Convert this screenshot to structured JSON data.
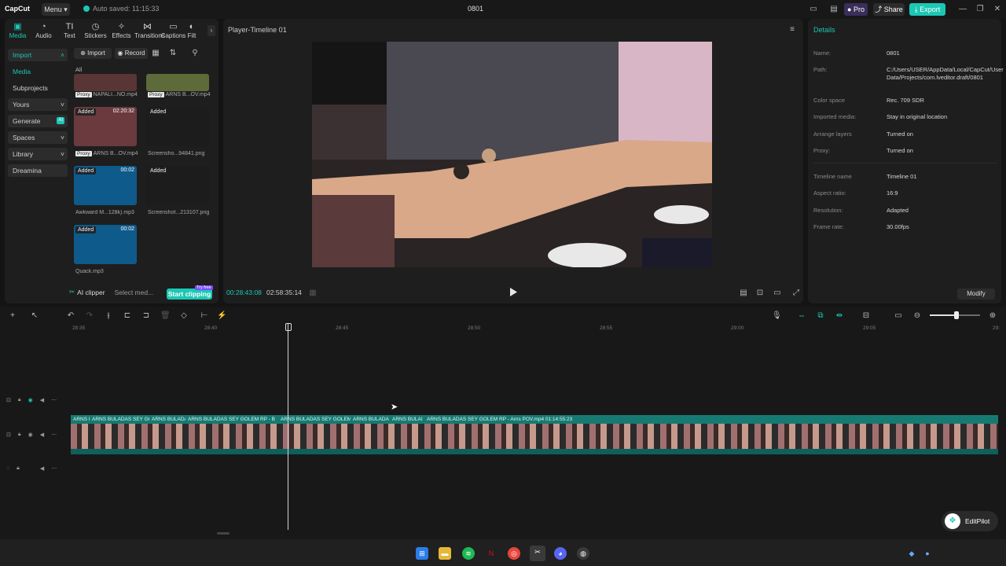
{
  "titlebar": {
    "app_name": "CapCut",
    "menu_label": "Menu",
    "autosave_text": "Auto saved: 11:15:33",
    "project_title": "0801",
    "pro_label": "Pro",
    "share_label": "Share",
    "export_label": "Export"
  },
  "tabs": [
    {
      "label": "Media",
      "icon": "media-icon"
    },
    {
      "label": "Audio",
      "icon": "audio-icon"
    },
    {
      "label": "Text",
      "icon": "text-icon"
    },
    {
      "label": "Stickers",
      "icon": "stickers-icon"
    },
    {
      "label": "Effects",
      "icon": "effects-icon"
    },
    {
      "label": "Transitions",
      "icon": "transitions-icon"
    },
    {
      "label": "Captions",
      "icon": "captions-icon"
    },
    {
      "label": "Filt",
      "icon": "filters-icon"
    }
  ],
  "sidenav": {
    "import": "Import",
    "media": "Media",
    "subprojects": "Subprojects",
    "yours": "Yours",
    "generate": "Generate",
    "generate_badge": "AI",
    "spaces": "Spaces",
    "library": "Library",
    "dreamina": "Dreamina"
  },
  "media": {
    "import_label": "Import",
    "record_label": "Record",
    "filter_all": "All",
    "proxy_label": "Proxy",
    "added_label": "Added",
    "items": [
      {
        "name": "NAPALI...NO.mp4",
        "duration": "",
        "added": false,
        "proxy": true
      },
      {
        "name": "ARNS B...OV.mp4",
        "duration": "",
        "added": false,
        "proxy": true
      },
      {
        "name": "ARNS B...OV.mp4",
        "duration": "02:20:32",
        "added": true,
        "proxy": true
      },
      {
        "name": "Screensho...94841.png",
        "duration": "",
        "added": true,
        "proxy": false
      },
      {
        "name": "Awkward M...128k).mp3",
        "duration": "00:02",
        "added": true,
        "proxy": false
      },
      {
        "name": "Screenshot...213107.png",
        "duration": "",
        "added": true,
        "proxy": false
      },
      {
        "name": "Quack.mp3",
        "duration": "00:02",
        "added": true,
        "proxy": false
      }
    ],
    "ai_clipper": "AI clipper",
    "select_media": "Select med...",
    "start_clipping": "Start clipping",
    "try_free": "Try free"
  },
  "player": {
    "title": "Player-Timeline 01",
    "current_time": "00:28:43:08",
    "total_time": "02:58:35:14"
  },
  "details": {
    "title": "Details",
    "rows": [
      {
        "key": "Name:",
        "value": "0801"
      },
      {
        "key": "Path:",
        "value": "C:/Users/USER/AppData/Local/CapCut/User Data/Projects/com.lveditor.draft/0801"
      },
      {
        "key": "Color space",
        "value": "Rec. 709 SDR"
      },
      {
        "key": "Imported media:",
        "value": "Stay in original location"
      },
      {
        "key": "Arrange layers",
        "value": "Turned on"
      },
      {
        "key": "Proxy:",
        "value": "Turned on"
      },
      {
        "key": "Timeline name",
        "value": "Timeline 01"
      },
      {
        "key": "Aspect ratio:",
        "value": "16:9"
      },
      {
        "key": "Resolution:",
        "value": "Adapted"
      },
      {
        "key": "Frame rate:",
        "value": "30.00fps"
      }
    ],
    "modify_label": "Modify"
  },
  "timeline": {
    "ruler": [
      "28:35",
      "28:40",
      "28:45",
      "28:50",
      "28:55",
      "29:00",
      "29:05",
      "29:"
    ],
    "clips": [
      "ARNS BULA",
      "ARNS BULADAS SEY GO",
      "ARNS BULADA",
      "ARNS BULADAS SEY GOLEM RP - B",
      "ARNS BULADAS SEY GOLEM",
      "ARNS BULADA",
      "ARNS BULAI",
      "ARNS BULADAS SEY GOLEM RP - Arns POV.mp4   01:14:55:23"
    ]
  },
  "editpilot": "EditPilot",
  "colors": {
    "accent": "#1cc7b4",
    "panel": "#1e1e1e",
    "background": "#141414"
  }
}
